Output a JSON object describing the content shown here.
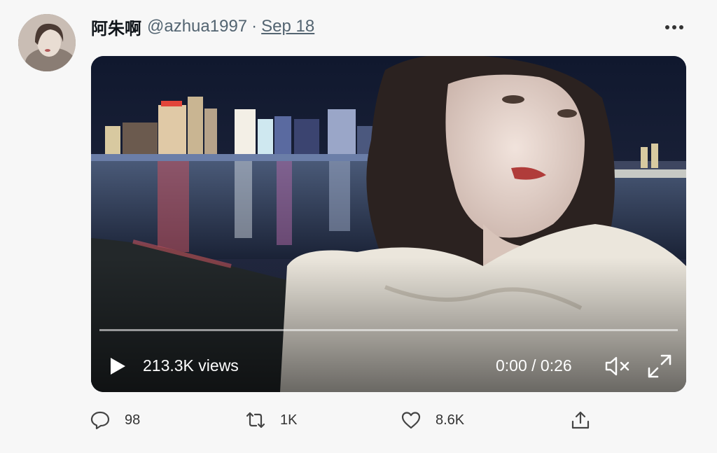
{
  "tweet": {
    "display_name": "阿朱啊",
    "handle": "@azhua1997",
    "separator": "·",
    "date": "Sep 18",
    "more_icon": "more-horizontal-icon"
  },
  "video": {
    "views": "213.3K views",
    "time": "0:00 / 0:26",
    "progress": 0,
    "play_icon": "play-icon",
    "mute_icon": "volume-muted-icon",
    "fullscreen_icon": "fullscreen-icon"
  },
  "actions": {
    "reply": {
      "icon": "reply-icon",
      "count": "98"
    },
    "retweet": {
      "icon": "retweet-icon",
      "count": "1K"
    },
    "like": {
      "icon": "heart-icon",
      "count": "8.6K"
    },
    "share": {
      "icon": "share-icon"
    }
  },
  "colors": {
    "accent": "#1d9bf0",
    "text_secondary": "#536471"
  }
}
